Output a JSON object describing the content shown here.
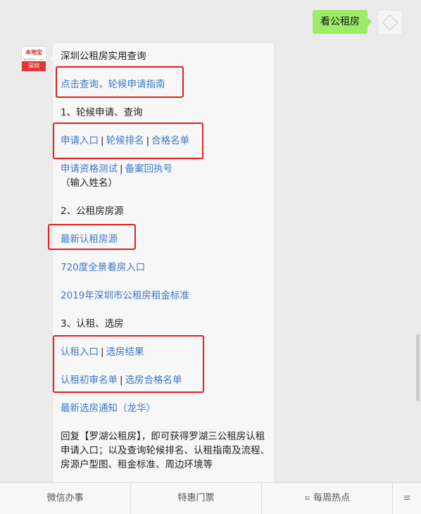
{
  "user_message": {
    "text": "看公租房"
  },
  "bot": {
    "logo_top": "本地宝",
    "logo_sub": "BenDiBao.com",
    "logo_city": "深圳",
    "title": "深圳公租房实用查询",
    "link_guide": "点击查询，轮候申请指南",
    "section1": "1、轮候申请、查询",
    "apply_entry": "申请入口",
    "queue_rank": "轮候排名",
    "qualified_list": "合格名单",
    "qualification_test": "申请资格测试",
    "record_receipt": "备案回执号",
    "input_name_note": "（输入姓名）",
    "section2": "2、公租房房源",
    "latest_listings": "最新认租房源",
    "vr_entry": "720度全景看房入口",
    "rent_standard": "2019年深圳市公租房租金标准",
    "section3": "3、认租、选房",
    "rent_entry": "认租入口",
    "select_result": "选房结果",
    "prelim_list": "认租初审名单",
    "select_qualified": "选房合格名单",
    "latest_notice": "最新选房通知（龙华）",
    "reply_para": "回复【罗湖公租房】，即可获得罗湖三公租房认租申请入口；以及查询轮候排名、认租指南及流程、房源户型图、租金标准、周边环境等",
    "separator": "|"
  },
  "menu": {
    "item1": "微信办事",
    "item2": "特惠门票",
    "item3": "每周热点",
    "item3_icon": "≡",
    "switch_icon": "≡"
  },
  "colors": {
    "link": "#3b79c8",
    "highlight_box": "#e32020",
    "user_bubble": "#9eea6a"
  }
}
